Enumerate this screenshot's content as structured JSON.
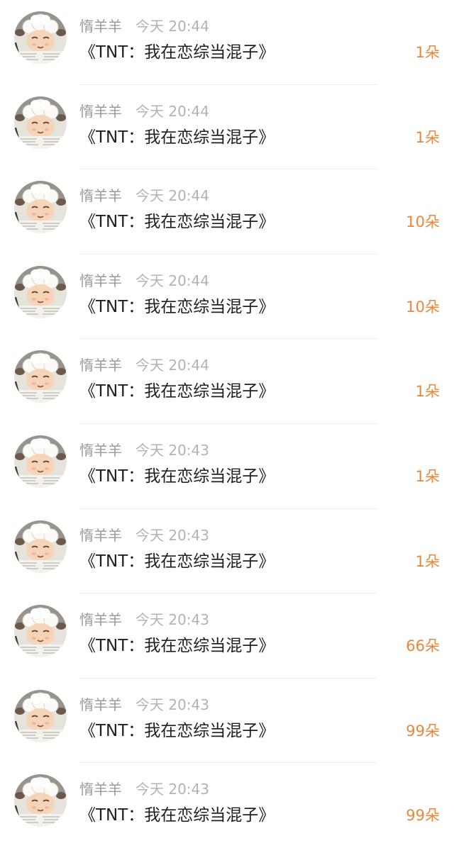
{
  "messages": [
    {
      "username": "惰羊羊",
      "time": "今天 20:44",
      "title": "《TNT：我在恋综当混子》",
      "gift": "1朵"
    },
    {
      "username": "惰羊羊",
      "time": "今天 20:44",
      "title": "《TNT：我在恋综当混子》",
      "gift": "1朵"
    },
    {
      "username": "惰羊羊",
      "time": "今天 20:44",
      "title": "《TNT：我在恋综当混子》",
      "gift": "10朵"
    },
    {
      "username": "惰羊羊",
      "time": "今天 20:44",
      "title": "《TNT：我在恋综当混子》",
      "gift": "10朵"
    },
    {
      "username": "惰羊羊",
      "time": "今天 20:44",
      "title": "《TNT：我在恋综当混子》",
      "gift": "1朵"
    },
    {
      "username": "惰羊羊",
      "time": "今天 20:43",
      "title": "《TNT：我在恋综当混子》",
      "gift": "1朵"
    },
    {
      "username": "惰羊羊",
      "time": "今天 20:43",
      "title": "《TNT：我在恋综当混子》",
      "gift": "1朵"
    },
    {
      "username": "惰羊羊",
      "time": "今天 20:43",
      "title": "《TNT：我在恋综当混子》",
      "gift": "66朵"
    },
    {
      "username": "惰羊羊",
      "time": "今天 20:43",
      "title": "《TNT：我在恋综当混子》",
      "gift": "99朵"
    },
    {
      "username": "惰羊羊",
      "time": "今天 20:43",
      "title": "《TNT：我在恋综当混子》",
      "gift": "99朵"
    }
  ],
  "colors": {
    "gift": "#e8873a",
    "username": "#9b9b9b",
    "time": "#b3b3b3",
    "title": "#1f1f1f"
  },
  "avatar_icon": "sheep-avatar-icon"
}
